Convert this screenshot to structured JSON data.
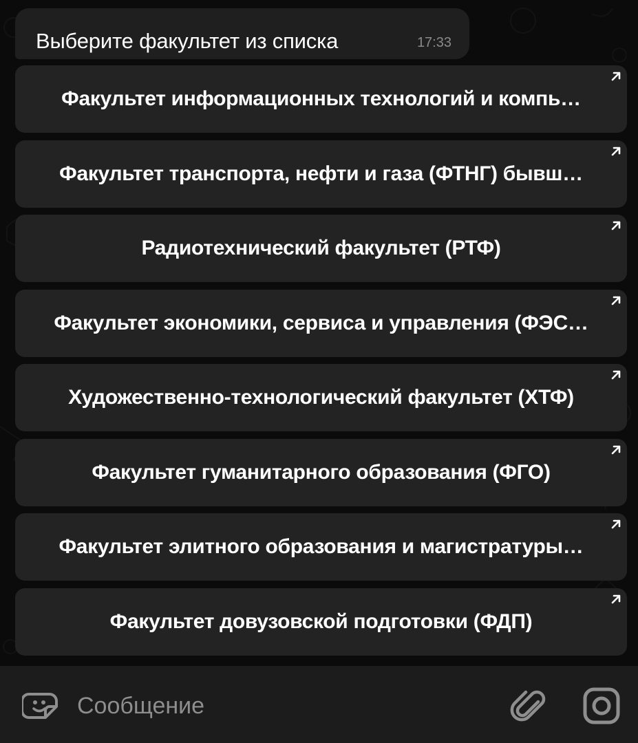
{
  "message": {
    "text": "Выберите факультет из списка",
    "time": "17:33"
  },
  "faculty_buttons": [
    {
      "label": "Факультет информационных технологий и компь…",
      "icon": "open-link-arrow-icon"
    },
    {
      "label": "Факультет транспорта, нефти и газа (ФТНГ) бывш…",
      "icon": "open-link-arrow-icon"
    },
    {
      "label": "Радиотехнический факультет (РТФ)",
      "icon": "open-link-arrow-icon"
    },
    {
      "label": "Факультет экономики, сервиса и управления (ФЭС…",
      "icon": "open-link-arrow-icon"
    },
    {
      "label": "Художественно-технологический факультет (ХТФ)",
      "icon": "open-link-arrow-icon"
    },
    {
      "label": "Факультет гуманитарного образования (ФГО)",
      "icon": "open-link-arrow-icon"
    },
    {
      "label": "Факультет элитного образования и магистратуры…",
      "icon": "open-link-arrow-icon"
    },
    {
      "label": "Факультет довузовской подготовки (ФДП)",
      "icon": "open-link-arrow-icon"
    }
  ],
  "composer": {
    "placeholder": "Сообщение",
    "value": "",
    "left_icon": "sticker-emoji-icon",
    "right_icons": [
      "paperclip-icon",
      "camera-icon"
    ]
  },
  "colors": {
    "background": "#0b0b0b",
    "bubble": "#1f1f1f",
    "button": "#232323",
    "composer": "#1c1c1c",
    "text": "#ffffff",
    "muted": "#8e8e8e"
  }
}
